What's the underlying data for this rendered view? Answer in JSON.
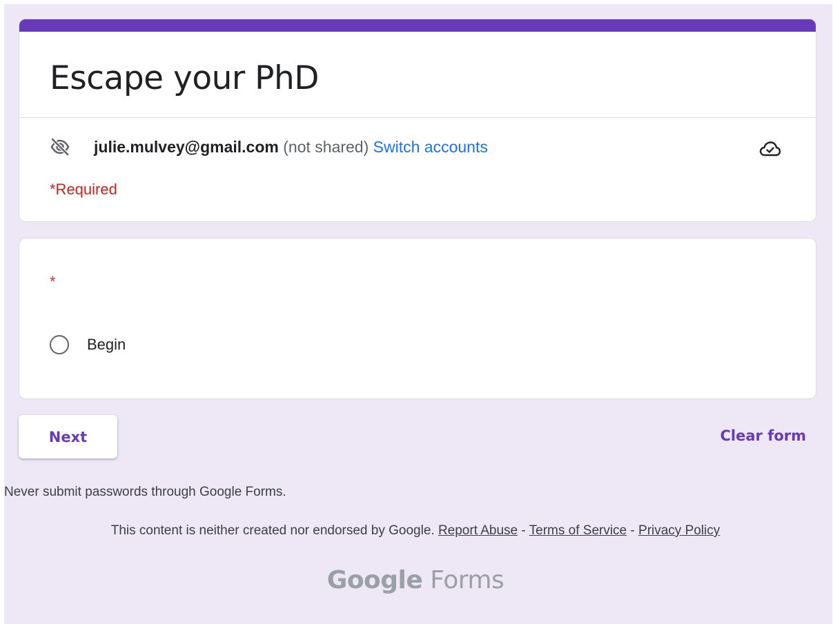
{
  "form": {
    "title": "Escape your PhD",
    "accent_color": "#673ab7"
  },
  "account": {
    "email": "julie.mulvey@gmail.com",
    "shared_status": "(not shared)",
    "switch_label": "Switch accounts",
    "privacy_icon": "eye-off-icon",
    "save_status_icon": "cloud-check-icon"
  },
  "required_note": "*Required",
  "question": {
    "required_marker": "*",
    "options": [
      {
        "label": "Begin",
        "selected": false
      }
    ]
  },
  "actions": {
    "next_label": "Next",
    "clear_label": "Clear form"
  },
  "footer": {
    "warning": "Never submit passwords through Google Forms.",
    "disclaimer": "This content is neither created nor endorsed by Google.",
    "sep1": "-",
    "sep2": "-",
    "links": {
      "report_abuse": "Report Abuse",
      "terms": "Terms of Service",
      "privacy": "Privacy Policy"
    },
    "logo_brand": "Google",
    "logo_product": "Forms"
  }
}
